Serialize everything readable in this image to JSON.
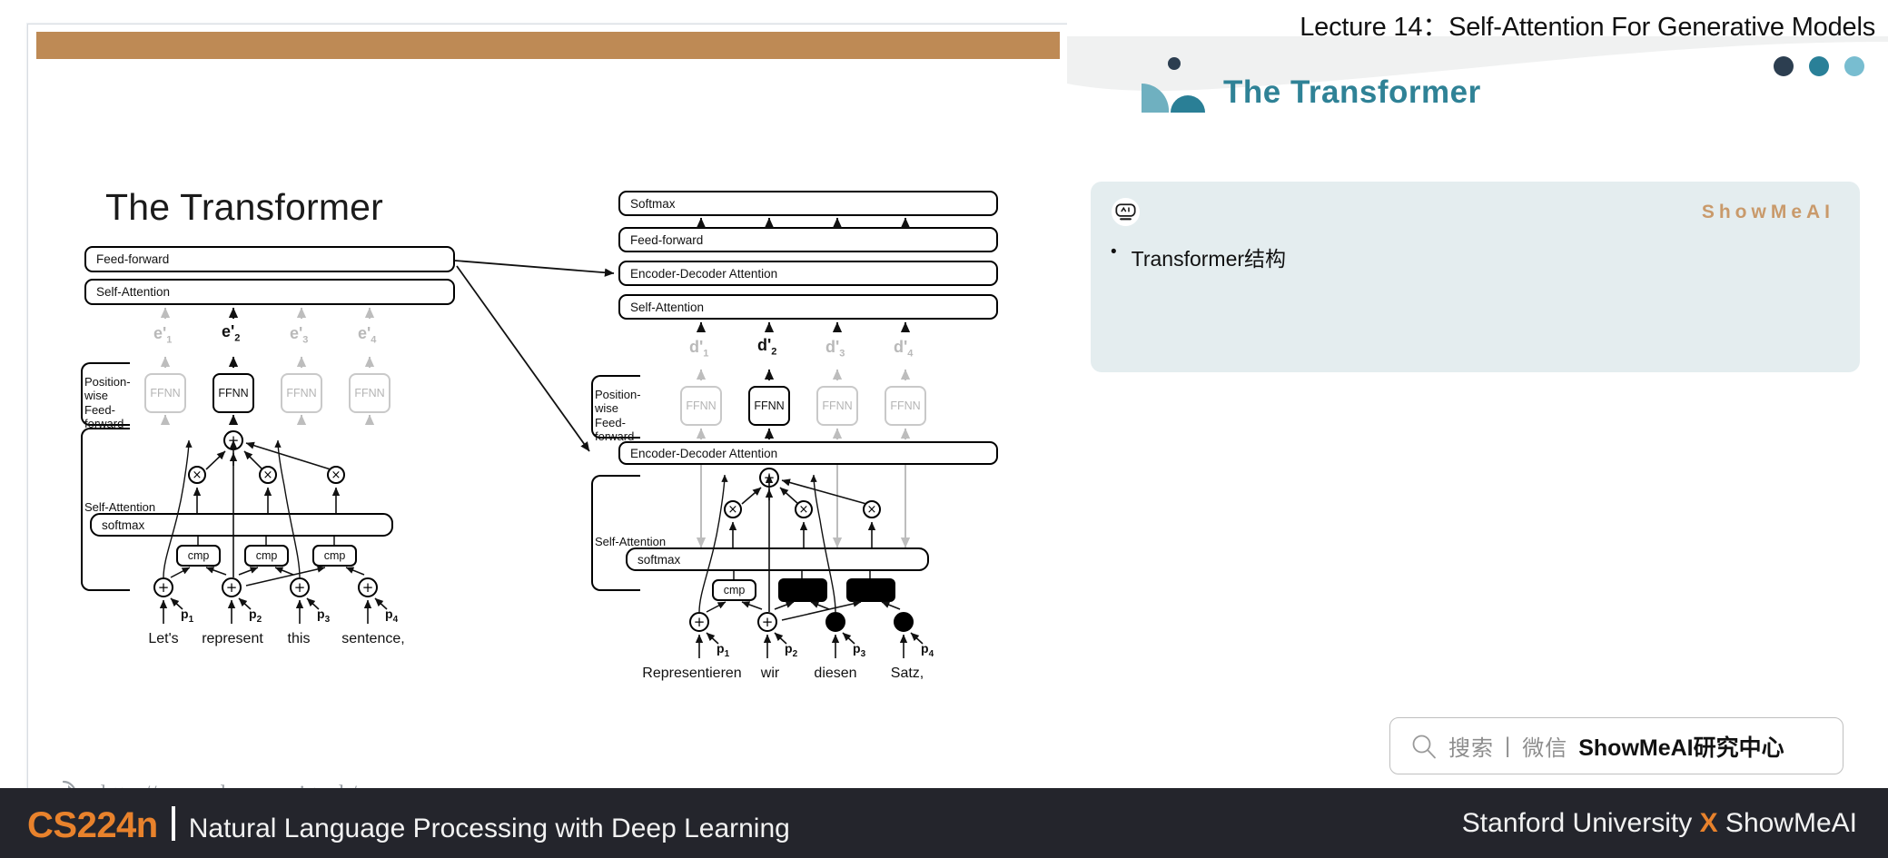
{
  "header": {
    "lecture_title": "Lecture 14：Self-Attention For Generative Models",
    "brand_name": "The Transformer",
    "dot_colors": [
      "#2c3e50",
      "#2a8098",
      "#78bdd0"
    ],
    "logo_color_light": "#6fb0c0",
    "logo_color_dark": "#2a7f96"
  },
  "card": {
    "badge_icon": "robot-face-icon",
    "brand": "ShowMeAI",
    "brand_color": "#c99a6b",
    "background": "#e4edef",
    "bullets": [
      {
        "marker": "•",
        "text": "Transformer结构"
      }
    ]
  },
  "search": {
    "icon": "search-icon",
    "label": "搜索",
    "divider": "|",
    "channel": "微信",
    "account": "ShowMeAI研究中心"
  },
  "footer": {
    "course_code": "CS224n",
    "course_name": "Natural Language Processing with Deep Learning",
    "right_prefix": "Stanford University ",
    "right_x": "X",
    "right_suffix": " ShowMeAI",
    "accent": "#e8822c",
    "background": "#24252c"
  },
  "slide": {
    "accent_color": "#be8a55",
    "title": "The Transformer",
    "watermark": {
      "icon": "cursor-arrow-icon",
      "url": "http://www.showmeai.tech/"
    },
    "encoder": {
      "stack_labels": [
        "Feed-forward",
        "Self-Attention"
      ],
      "group_labels": [
        "Position-wise\nFeed-forward",
        "Self-Attention"
      ],
      "softmax_label": "softmax",
      "ffnn_label": "FFNN",
      "cmp_label": "cmp",
      "embeddings": [
        "e'1",
        "e'2",
        "e'3",
        "e'4"
      ],
      "embedding_active_index": 1,
      "positions": [
        "p1",
        "p2",
        "p3",
        "p4"
      ],
      "tokens": [
        "Let's",
        "represent",
        "this",
        "sentence,"
      ]
    },
    "decoder": {
      "stack_labels": [
        "Softmax",
        "Feed-forward",
        "Encoder-Decoder Attention",
        "Self-Attention"
      ],
      "mid_label": "Encoder-Decoder Attention",
      "group_labels": [
        "Position-wise\nFeed-forward",
        "Self-Attention"
      ],
      "softmax_label": "softmax",
      "ffnn_label": "FFNN",
      "cmp_label": "cmp",
      "embeddings": [
        "d'1",
        "d'2",
        "d'3",
        "d'4"
      ],
      "embedding_active_index": 1,
      "positions": [
        "p1",
        "p2",
        "p3",
        "p4"
      ],
      "tokens": [
        "Representieren",
        "wir",
        "diesen",
        "Satz,"
      ],
      "masked_indices": [
        2,
        3
      ]
    }
  }
}
